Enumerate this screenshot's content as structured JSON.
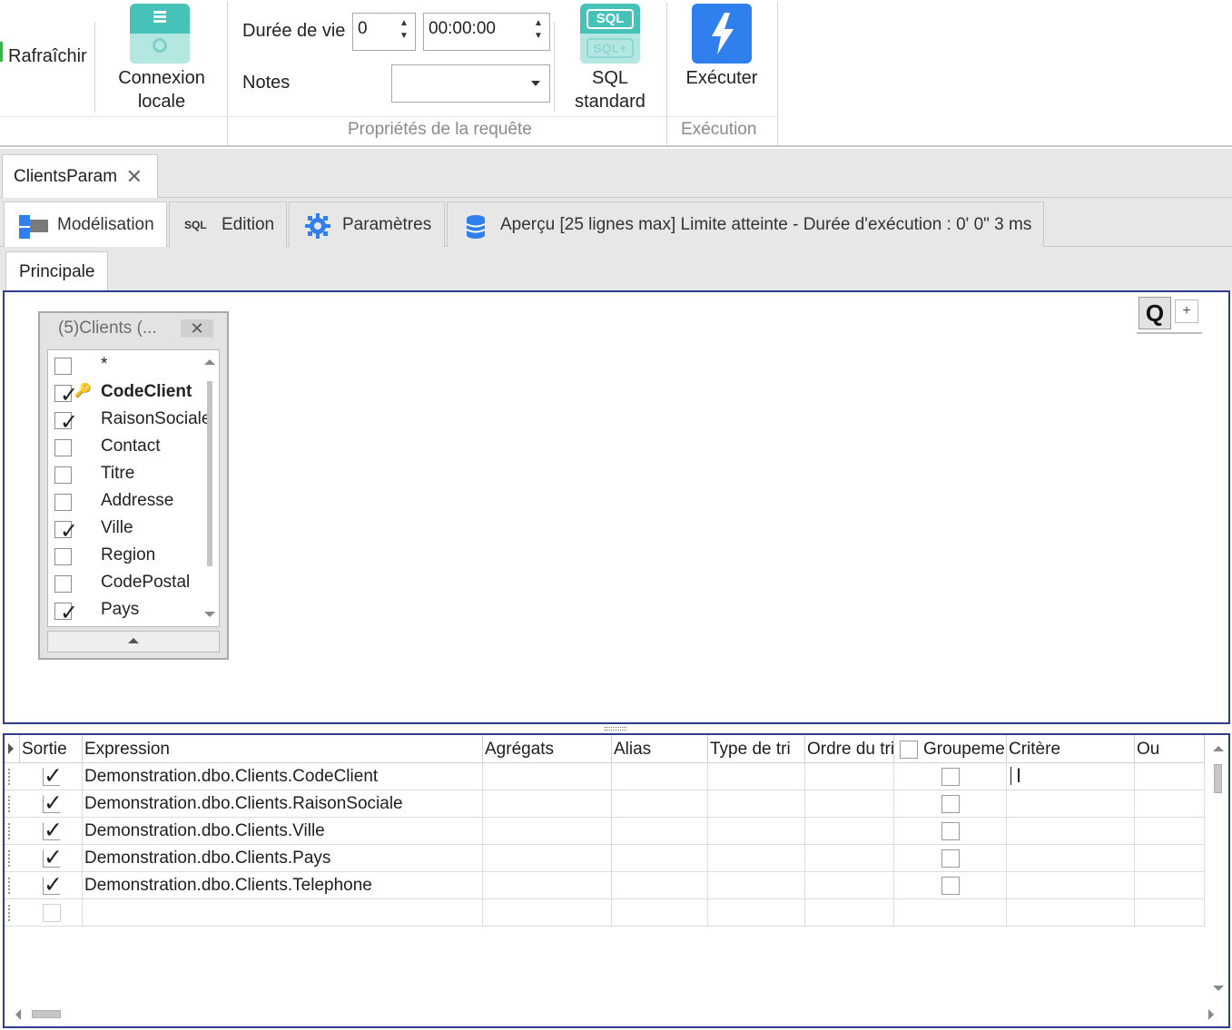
{
  "ribbon": {
    "refresh_label": "Rafraîchir",
    "local_connection_label_1": "Connexion",
    "local_connection_label_2": "locale",
    "lifetime_label": "Durée de vie",
    "lifetime_value": "0",
    "lifetime_time": "00:00:00",
    "notes_label": "Notes",
    "notes_value": "",
    "sql_standard_label_1": "SQL",
    "sql_standard_label_2": "standard",
    "sql_icon_text_1": "SQL",
    "sql_icon_text_2": "SQL+",
    "query_props_group": "Propriétés de la requête",
    "execute_label": "Exécuter",
    "execution_group": "Exécution",
    "accent_teal": "#46c2b8",
    "accent_blue": "#2f80ed"
  },
  "document_tab": {
    "label": "ClientsParam",
    "close_symbol": "✕"
  },
  "view_tabs": [
    {
      "label": "Modélisation",
      "icon": "modeling-icon",
      "active": true
    },
    {
      "label": "Edition",
      "icon": "sql-icon",
      "icon_text": "SQL",
      "active": false
    },
    {
      "label": "Paramètres",
      "icon": "gear-icon",
      "active": false
    },
    {
      "label": "Aperçu [25 lignes max] Limite atteinte - Durée d'exécution : 0' 0\" 3 ms",
      "icon": "database-icon",
      "active": false
    }
  ],
  "sub_tab": {
    "label": "Principale"
  },
  "design": {
    "zoom_q": "Q",
    "zoom_plus": "+",
    "table": {
      "title": "(5)Clients (...",
      "close_symbol": "✕",
      "fields": [
        {
          "name": "*",
          "checked": false,
          "key": false,
          "bold": false
        },
        {
          "name": "CodeClient",
          "checked": true,
          "key": true,
          "bold": true
        },
        {
          "name": "RaisonSociale",
          "checked": true,
          "key": false,
          "bold": false
        },
        {
          "name": "Contact",
          "checked": false,
          "key": false,
          "bold": false
        },
        {
          "name": "Titre",
          "checked": false,
          "key": false,
          "bold": false
        },
        {
          "name": "Addresse",
          "checked": false,
          "key": false,
          "bold": false
        },
        {
          "name": "Ville",
          "checked": true,
          "key": false,
          "bold": false
        },
        {
          "name": "Region",
          "checked": false,
          "key": false,
          "bold": false
        },
        {
          "name": "CodePostal",
          "checked": false,
          "key": false,
          "bold": false
        },
        {
          "name": "Pays",
          "checked": true,
          "key": false,
          "bold": false
        }
      ]
    }
  },
  "grid": {
    "columns": [
      "Sortie",
      "Expression",
      "Agrégats",
      "Alias",
      "Type de tri",
      "Ordre du tri",
      "Groupement",
      "Critère",
      "Ou"
    ],
    "rows": [
      {
        "output": true,
        "expression": "Demonstration.dbo.Clients.CodeClient",
        "group": false
      },
      {
        "output": true,
        "expression": "Demonstration.dbo.Clients.RaisonSociale",
        "group": false
      },
      {
        "output": true,
        "expression": "Demonstration.dbo.Clients.Ville",
        "group": false
      },
      {
        "output": true,
        "expression": "Demonstration.dbo.Clients.Pays",
        "group": false
      },
      {
        "output": true,
        "expression": "Demonstration.dbo.Clients.Telephone",
        "group": false
      },
      {
        "output": false,
        "expression": "",
        "group": null
      }
    ],
    "check_symbol": "✓"
  },
  "frame_color": "#2f3b8c"
}
